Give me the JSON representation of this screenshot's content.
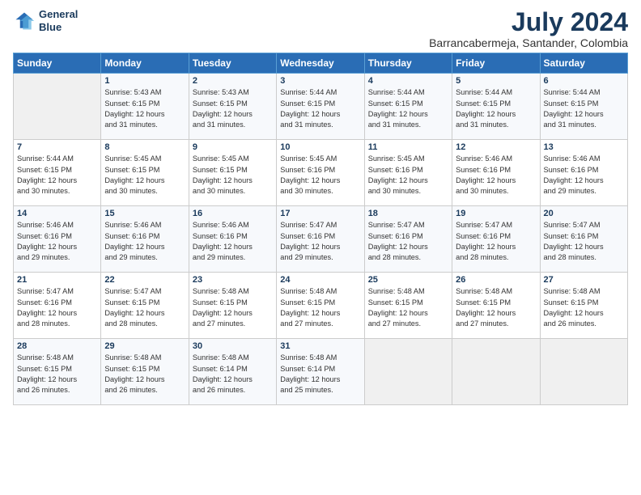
{
  "header": {
    "logo_line1": "General",
    "logo_line2": "Blue",
    "month_year": "July 2024",
    "location": "Barrancabermeja, Santander, Colombia"
  },
  "days_of_week": [
    "Sunday",
    "Monday",
    "Tuesday",
    "Wednesday",
    "Thursday",
    "Friday",
    "Saturday"
  ],
  "weeks": [
    [
      {
        "day": "",
        "info": ""
      },
      {
        "day": "1",
        "info": "Sunrise: 5:43 AM\nSunset: 6:15 PM\nDaylight: 12 hours\nand 31 minutes."
      },
      {
        "day": "2",
        "info": "Sunrise: 5:43 AM\nSunset: 6:15 PM\nDaylight: 12 hours\nand 31 minutes."
      },
      {
        "day": "3",
        "info": "Sunrise: 5:44 AM\nSunset: 6:15 PM\nDaylight: 12 hours\nand 31 minutes."
      },
      {
        "day": "4",
        "info": "Sunrise: 5:44 AM\nSunset: 6:15 PM\nDaylight: 12 hours\nand 31 minutes."
      },
      {
        "day": "5",
        "info": "Sunrise: 5:44 AM\nSunset: 6:15 PM\nDaylight: 12 hours\nand 31 minutes."
      },
      {
        "day": "6",
        "info": "Sunrise: 5:44 AM\nSunset: 6:15 PM\nDaylight: 12 hours\nand 31 minutes."
      }
    ],
    [
      {
        "day": "7",
        "info": "Sunrise: 5:44 AM\nSunset: 6:15 PM\nDaylight: 12 hours\nand 30 minutes."
      },
      {
        "day": "8",
        "info": "Sunrise: 5:45 AM\nSunset: 6:15 PM\nDaylight: 12 hours\nand 30 minutes."
      },
      {
        "day": "9",
        "info": "Sunrise: 5:45 AM\nSunset: 6:15 PM\nDaylight: 12 hours\nand 30 minutes."
      },
      {
        "day": "10",
        "info": "Sunrise: 5:45 AM\nSunset: 6:16 PM\nDaylight: 12 hours\nand 30 minutes."
      },
      {
        "day": "11",
        "info": "Sunrise: 5:45 AM\nSunset: 6:16 PM\nDaylight: 12 hours\nand 30 minutes."
      },
      {
        "day": "12",
        "info": "Sunrise: 5:46 AM\nSunset: 6:16 PM\nDaylight: 12 hours\nand 30 minutes."
      },
      {
        "day": "13",
        "info": "Sunrise: 5:46 AM\nSunset: 6:16 PM\nDaylight: 12 hours\nand 29 minutes."
      }
    ],
    [
      {
        "day": "14",
        "info": "Sunrise: 5:46 AM\nSunset: 6:16 PM\nDaylight: 12 hours\nand 29 minutes."
      },
      {
        "day": "15",
        "info": "Sunrise: 5:46 AM\nSunset: 6:16 PM\nDaylight: 12 hours\nand 29 minutes."
      },
      {
        "day": "16",
        "info": "Sunrise: 5:46 AM\nSunset: 6:16 PM\nDaylight: 12 hours\nand 29 minutes."
      },
      {
        "day": "17",
        "info": "Sunrise: 5:47 AM\nSunset: 6:16 PM\nDaylight: 12 hours\nand 29 minutes."
      },
      {
        "day": "18",
        "info": "Sunrise: 5:47 AM\nSunset: 6:16 PM\nDaylight: 12 hours\nand 28 minutes."
      },
      {
        "day": "19",
        "info": "Sunrise: 5:47 AM\nSunset: 6:16 PM\nDaylight: 12 hours\nand 28 minutes."
      },
      {
        "day": "20",
        "info": "Sunrise: 5:47 AM\nSunset: 6:16 PM\nDaylight: 12 hours\nand 28 minutes."
      }
    ],
    [
      {
        "day": "21",
        "info": "Sunrise: 5:47 AM\nSunset: 6:16 PM\nDaylight: 12 hours\nand 28 minutes."
      },
      {
        "day": "22",
        "info": "Sunrise: 5:47 AM\nSunset: 6:15 PM\nDaylight: 12 hours\nand 28 minutes."
      },
      {
        "day": "23",
        "info": "Sunrise: 5:48 AM\nSunset: 6:15 PM\nDaylight: 12 hours\nand 27 minutes."
      },
      {
        "day": "24",
        "info": "Sunrise: 5:48 AM\nSunset: 6:15 PM\nDaylight: 12 hours\nand 27 minutes."
      },
      {
        "day": "25",
        "info": "Sunrise: 5:48 AM\nSunset: 6:15 PM\nDaylight: 12 hours\nand 27 minutes."
      },
      {
        "day": "26",
        "info": "Sunrise: 5:48 AM\nSunset: 6:15 PM\nDaylight: 12 hours\nand 27 minutes."
      },
      {
        "day": "27",
        "info": "Sunrise: 5:48 AM\nSunset: 6:15 PM\nDaylight: 12 hours\nand 26 minutes."
      }
    ],
    [
      {
        "day": "28",
        "info": "Sunrise: 5:48 AM\nSunset: 6:15 PM\nDaylight: 12 hours\nand 26 minutes."
      },
      {
        "day": "29",
        "info": "Sunrise: 5:48 AM\nSunset: 6:15 PM\nDaylight: 12 hours\nand 26 minutes."
      },
      {
        "day": "30",
        "info": "Sunrise: 5:48 AM\nSunset: 6:14 PM\nDaylight: 12 hours\nand 26 minutes."
      },
      {
        "day": "31",
        "info": "Sunrise: 5:48 AM\nSunset: 6:14 PM\nDaylight: 12 hours\nand 25 minutes."
      },
      {
        "day": "",
        "info": ""
      },
      {
        "day": "",
        "info": ""
      },
      {
        "day": "",
        "info": ""
      }
    ]
  ]
}
